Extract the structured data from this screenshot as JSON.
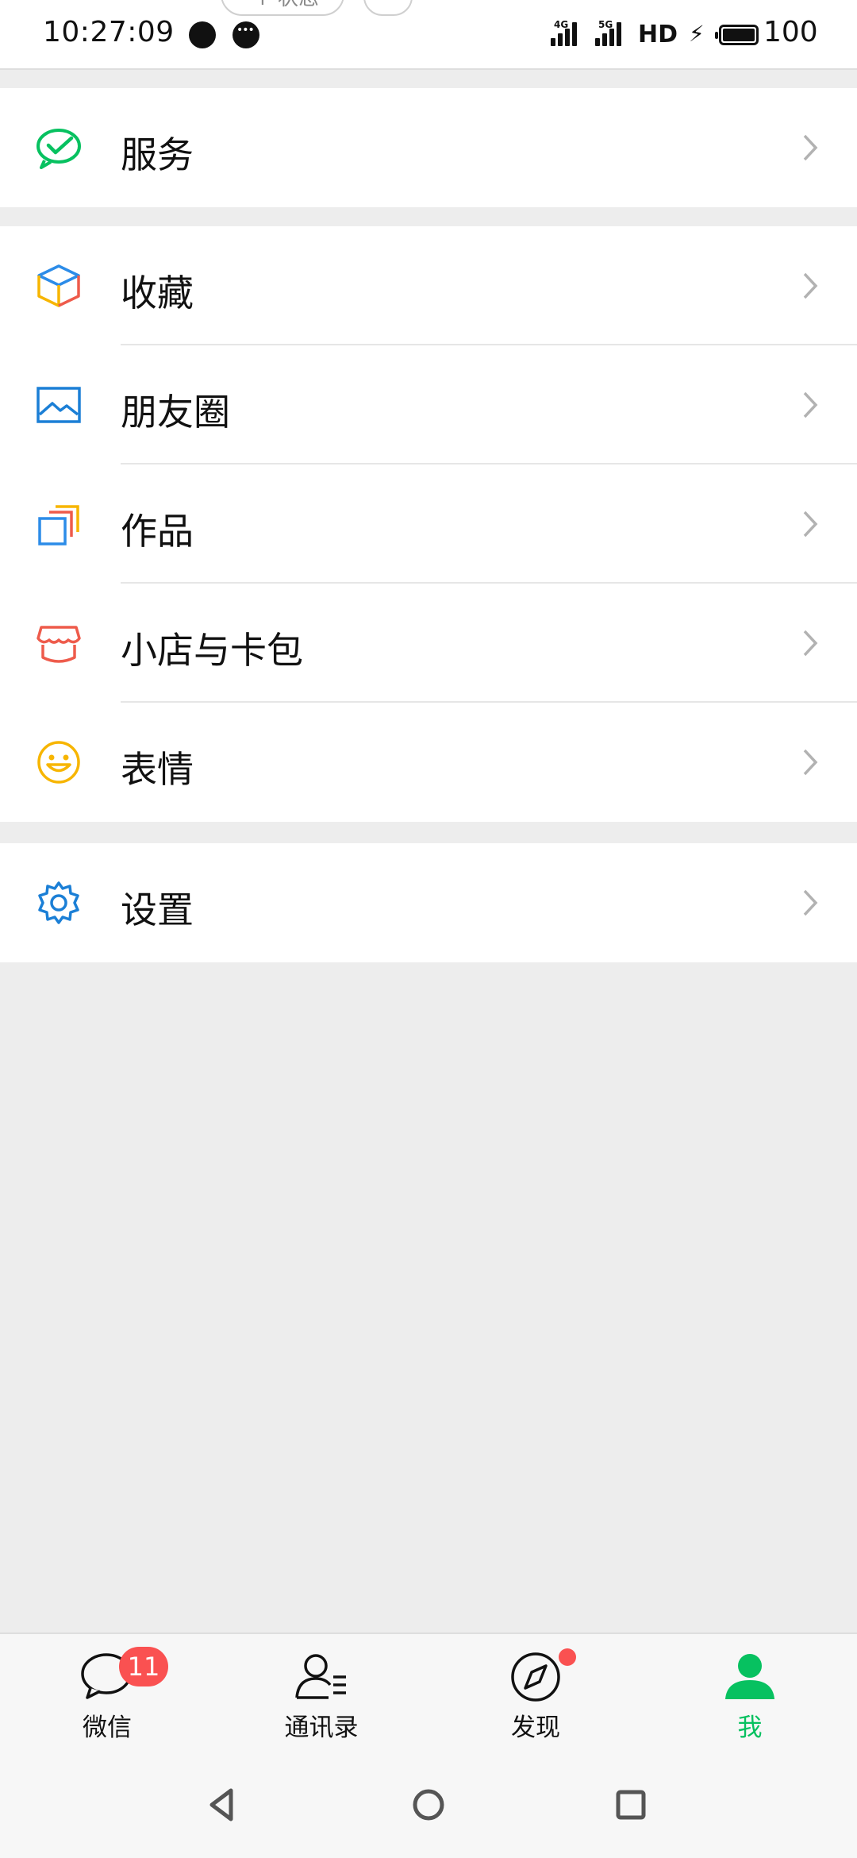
{
  "status_bar": {
    "time": "10:27:09",
    "network1": "4G",
    "network2": "5G",
    "hd": "HD",
    "battery": "100",
    "top_pill_text": "+ 状态"
  },
  "menu": {
    "group1": [
      {
        "label": "服务",
        "icon": "wechat-pay-icon",
        "color": "#07c160"
      }
    ],
    "group2": [
      {
        "label": "收藏",
        "icon": "cube-icon",
        "color": "#2c8ce8"
      },
      {
        "label": "朋友圈",
        "icon": "picture-icon",
        "color": "#1b7fd6"
      },
      {
        "label": "作品",
        "icon": "works-icon",
        "color": "#2c8ce8"
      },
      {
        "label": "小店与卡包",
        "icon": "shop-icon",
        "color": "#ee5b4b"
      },
      {
        "label": "表情",
        "icon": "smile-icon",
        "color": "#f7b500"
      }
    ],
    "group3": [
      {
        "label": "设置",
        "icon": "gear-icon",
        "color": "#1b7fd6"
      }
    ]
  },
  "tabbar": {
    "tabs": [
      {
        "label": "微信",
        "badge": "11"
      },
      {
        "label": "通讯录"
      },
      {
        "label": "发现"
      },
      {
        "label": "我"
      }
    ],
    "active_color": "#07c160"
  }
}
